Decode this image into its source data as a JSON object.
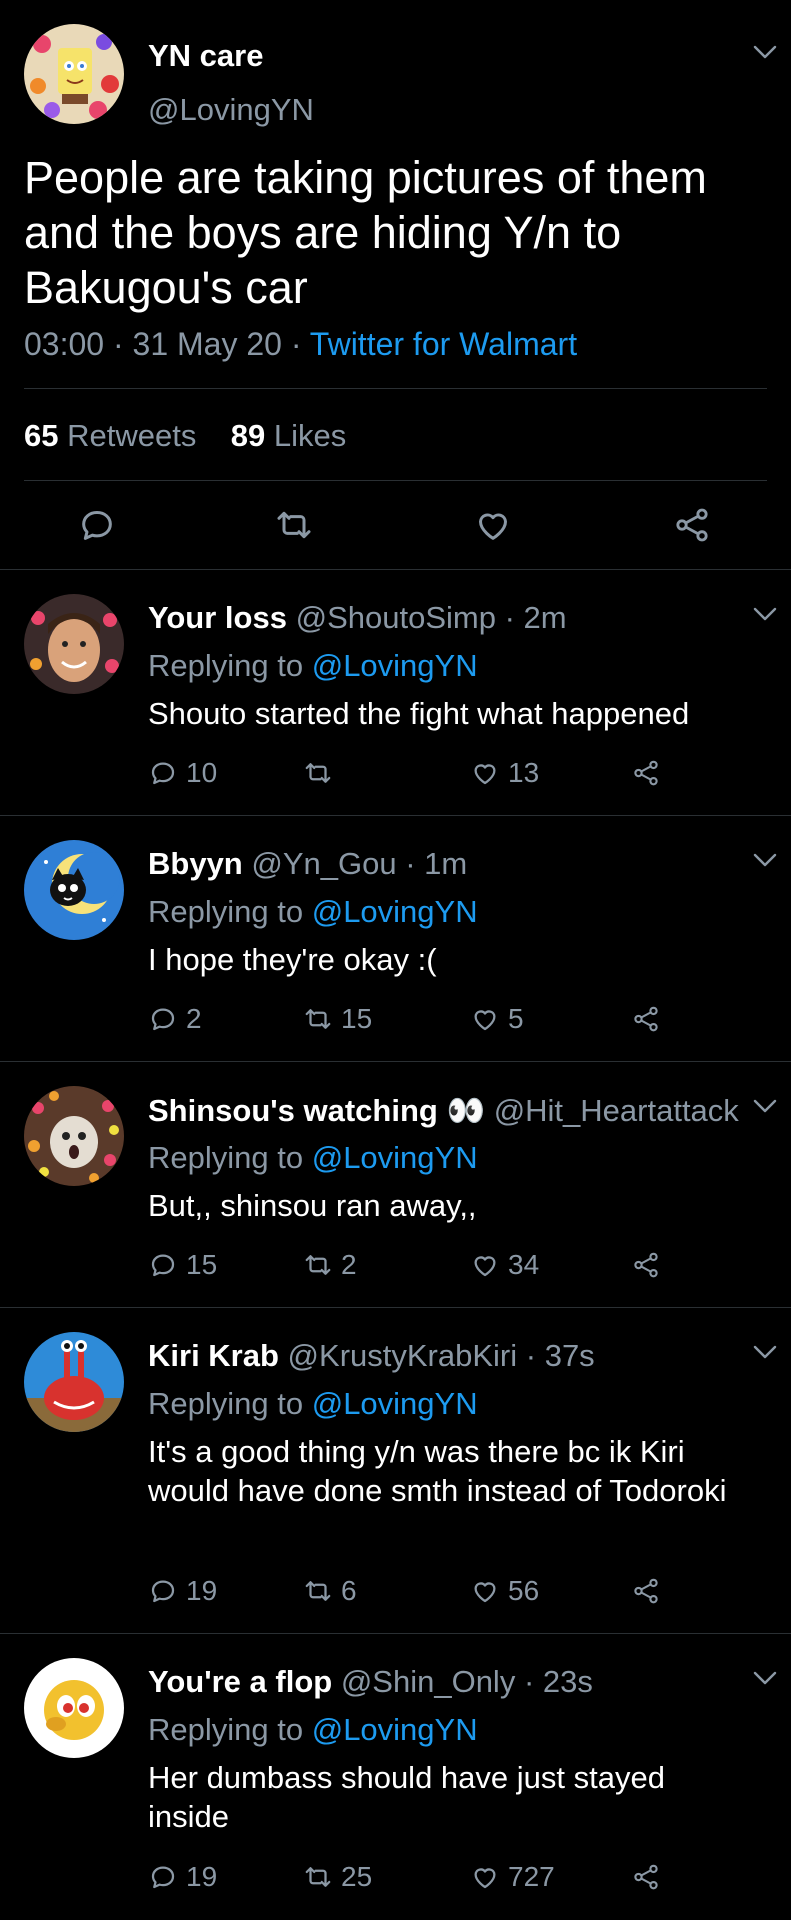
{
  "main_tweet": {
    "name": "YN care",
    "handle": "@LovingYN",
    "text": "People are taking pictures of them and the boys are hiding Y/n to Bakugou's car",
    "time": "03:00",
    "date": "31 May 20",
    "source": "Twitter for Walmart",
    "retweets_count": "65",
    "retweets_label": "Retweets",
    "likes_count": "89",
    "likes_label": "Likes"
  },
  "replying_label": "Replying to",
  "replies": [
    {
      "name": "Your loss",
      "handle": "@ShoutoSimp",
      "time": "· 2m",
      "replying_to": "@LovingYN",
      "text": "Shouto started the fight what happened",
      "replies": "10",
      "retweets": "",
      "likes": "13"
    },
    {
      "name": "Bbyyn",
      "handle": "@Yn_Gou",
      "time": "· 1m",
      "replying_to": "@LovingYN",
      "text": "I hope they're okay :(",
      "replies": "2",
      "retweets": "15",
      "likes": "5"
    },
    {
      "name": "Shinsou's watching 👀",
      "handle": "@Hit_Heartattack",
      "time": "·",
      "replying_to": "@LovingYN",
      "text": "But,, shinsou ran away,,",
      "replies": "15",
      "retweets": "2",
      "likes": "34"
    },
    {
      "name": "Kiri Krab",
      "handle": "@KrustyKrabKiri",
      "time": "· 37s",
      "replying_to": "@LovingYN",
      "text": "It's a good thing y/n was there bc ik Kiri would have done smth instead of Todoroki",
      "replies": "19",
      "retweets": "6",
      "likes": "56"
    },
    {
      "name": "You're a flop",
      "handle": "@Shin_Only",
      "time": "· 23s",
      "replying_to": "@LovingYN",
      "text": "Her dumbass should have just stayed inside",
      "replies": "19",
      "retweets": "25",
      "likes": "727"
    }
  ],
  "colors": {
    "background": "#000000",
    "muted_text": "#8b98a5",
    "link_blue": "#1d9bf0",
    "divider": "#2a2f33"
  },
  "icons": [
    "chevron-down-icon",
    "reply-icon",
    "retweet-icon",
    "like-icon",
    "share-icon"
  ]
}
